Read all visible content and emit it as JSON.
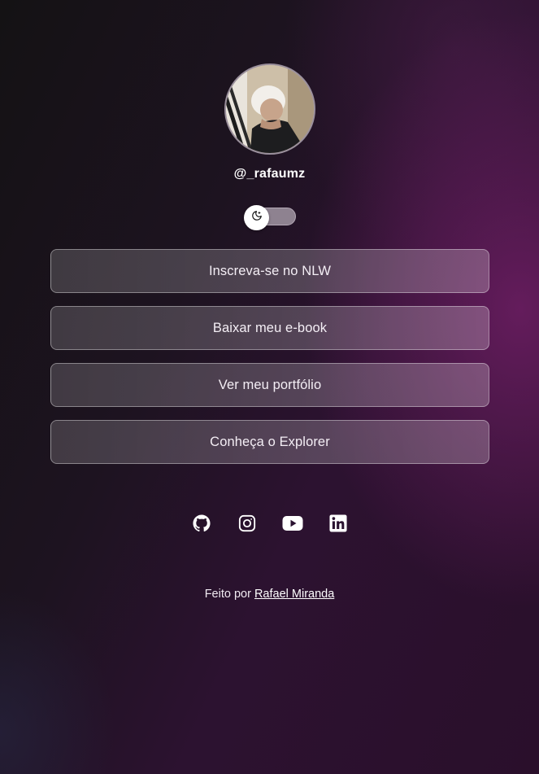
{
  "profile": {
    "username": "@_rafaumz",
    "avatar_alt": "foto de perfil"
  },
  "theme_switch": {
    "icon": "moon-icon",
    "state": "dark"
  },
  "links": [
    {
      "label": "Inscreva-se no NLW"
    },
    {
      "label": "Baixar meu e-book"
    },
    {
      "label": "Ver meu portfólio"
    },
    {
      "label": "Conheça o Explorer"
    }
  ],
  "social": [
    {
      "icon": "github-icon"
    },
    {
      "icon": "instagram-icon"
    },
    {
      "icon": "youtube-icon"
    },
    {
      "icon": "linkedin-icon"
    }
  ],
  "footer": {
    "prefix": "Feito por ",
    "author": "Rafael Miranda"
  },
  "colors": {
    "background_dark": "#141214",
    "background_accent": "#6e1e64",
    "button_border": "#9a8f9c",
    "text": "#ffffff"
  }
}
